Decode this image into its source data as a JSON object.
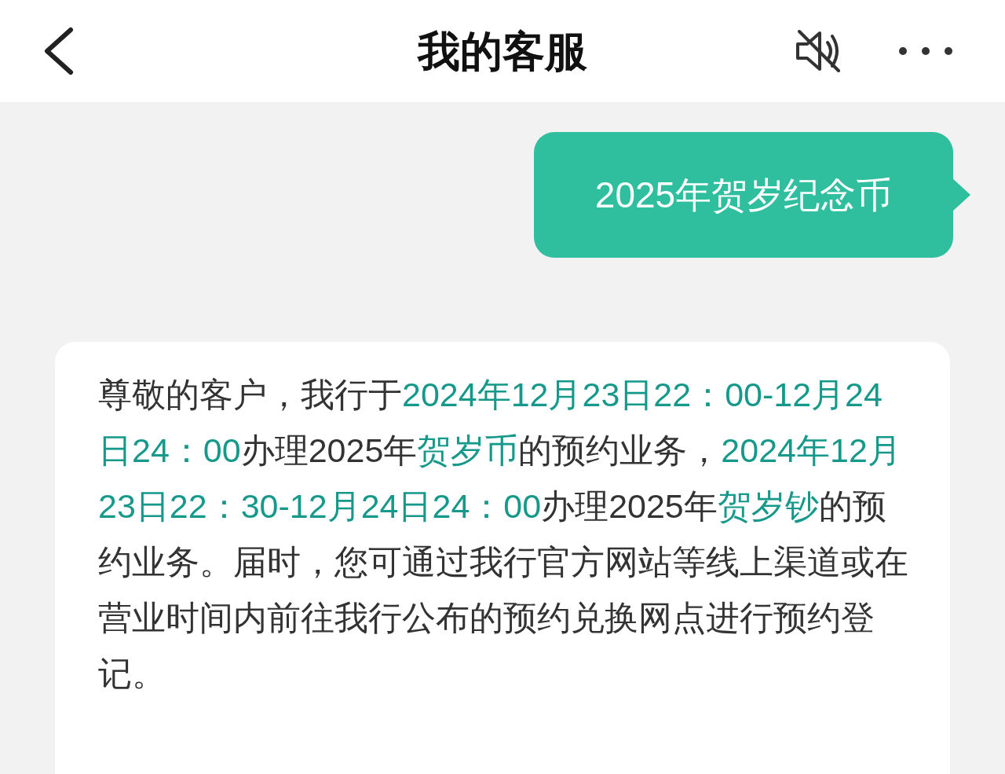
{
  "header": {
    "title": "我的客服"
  },
  "messages": [
    {
      "kind": "sent",
      "text": "2025年贺岁纪念币"
    },
    {
      "kind": "received",
      "text": "尊敬的客户，我行于**2024年12月23日22：00-12月24日24：00**办理2025年**贺岁币**的预约业务，**2024年12月23日22：30-12月24日24：00**办理2025年**贺岁钞**的预约业务。届时，您可通过我行官方网站等线上渠道或在营业时间内前往我行公布的预约兑换网点进行预约登记。"
    }
  ]
}
